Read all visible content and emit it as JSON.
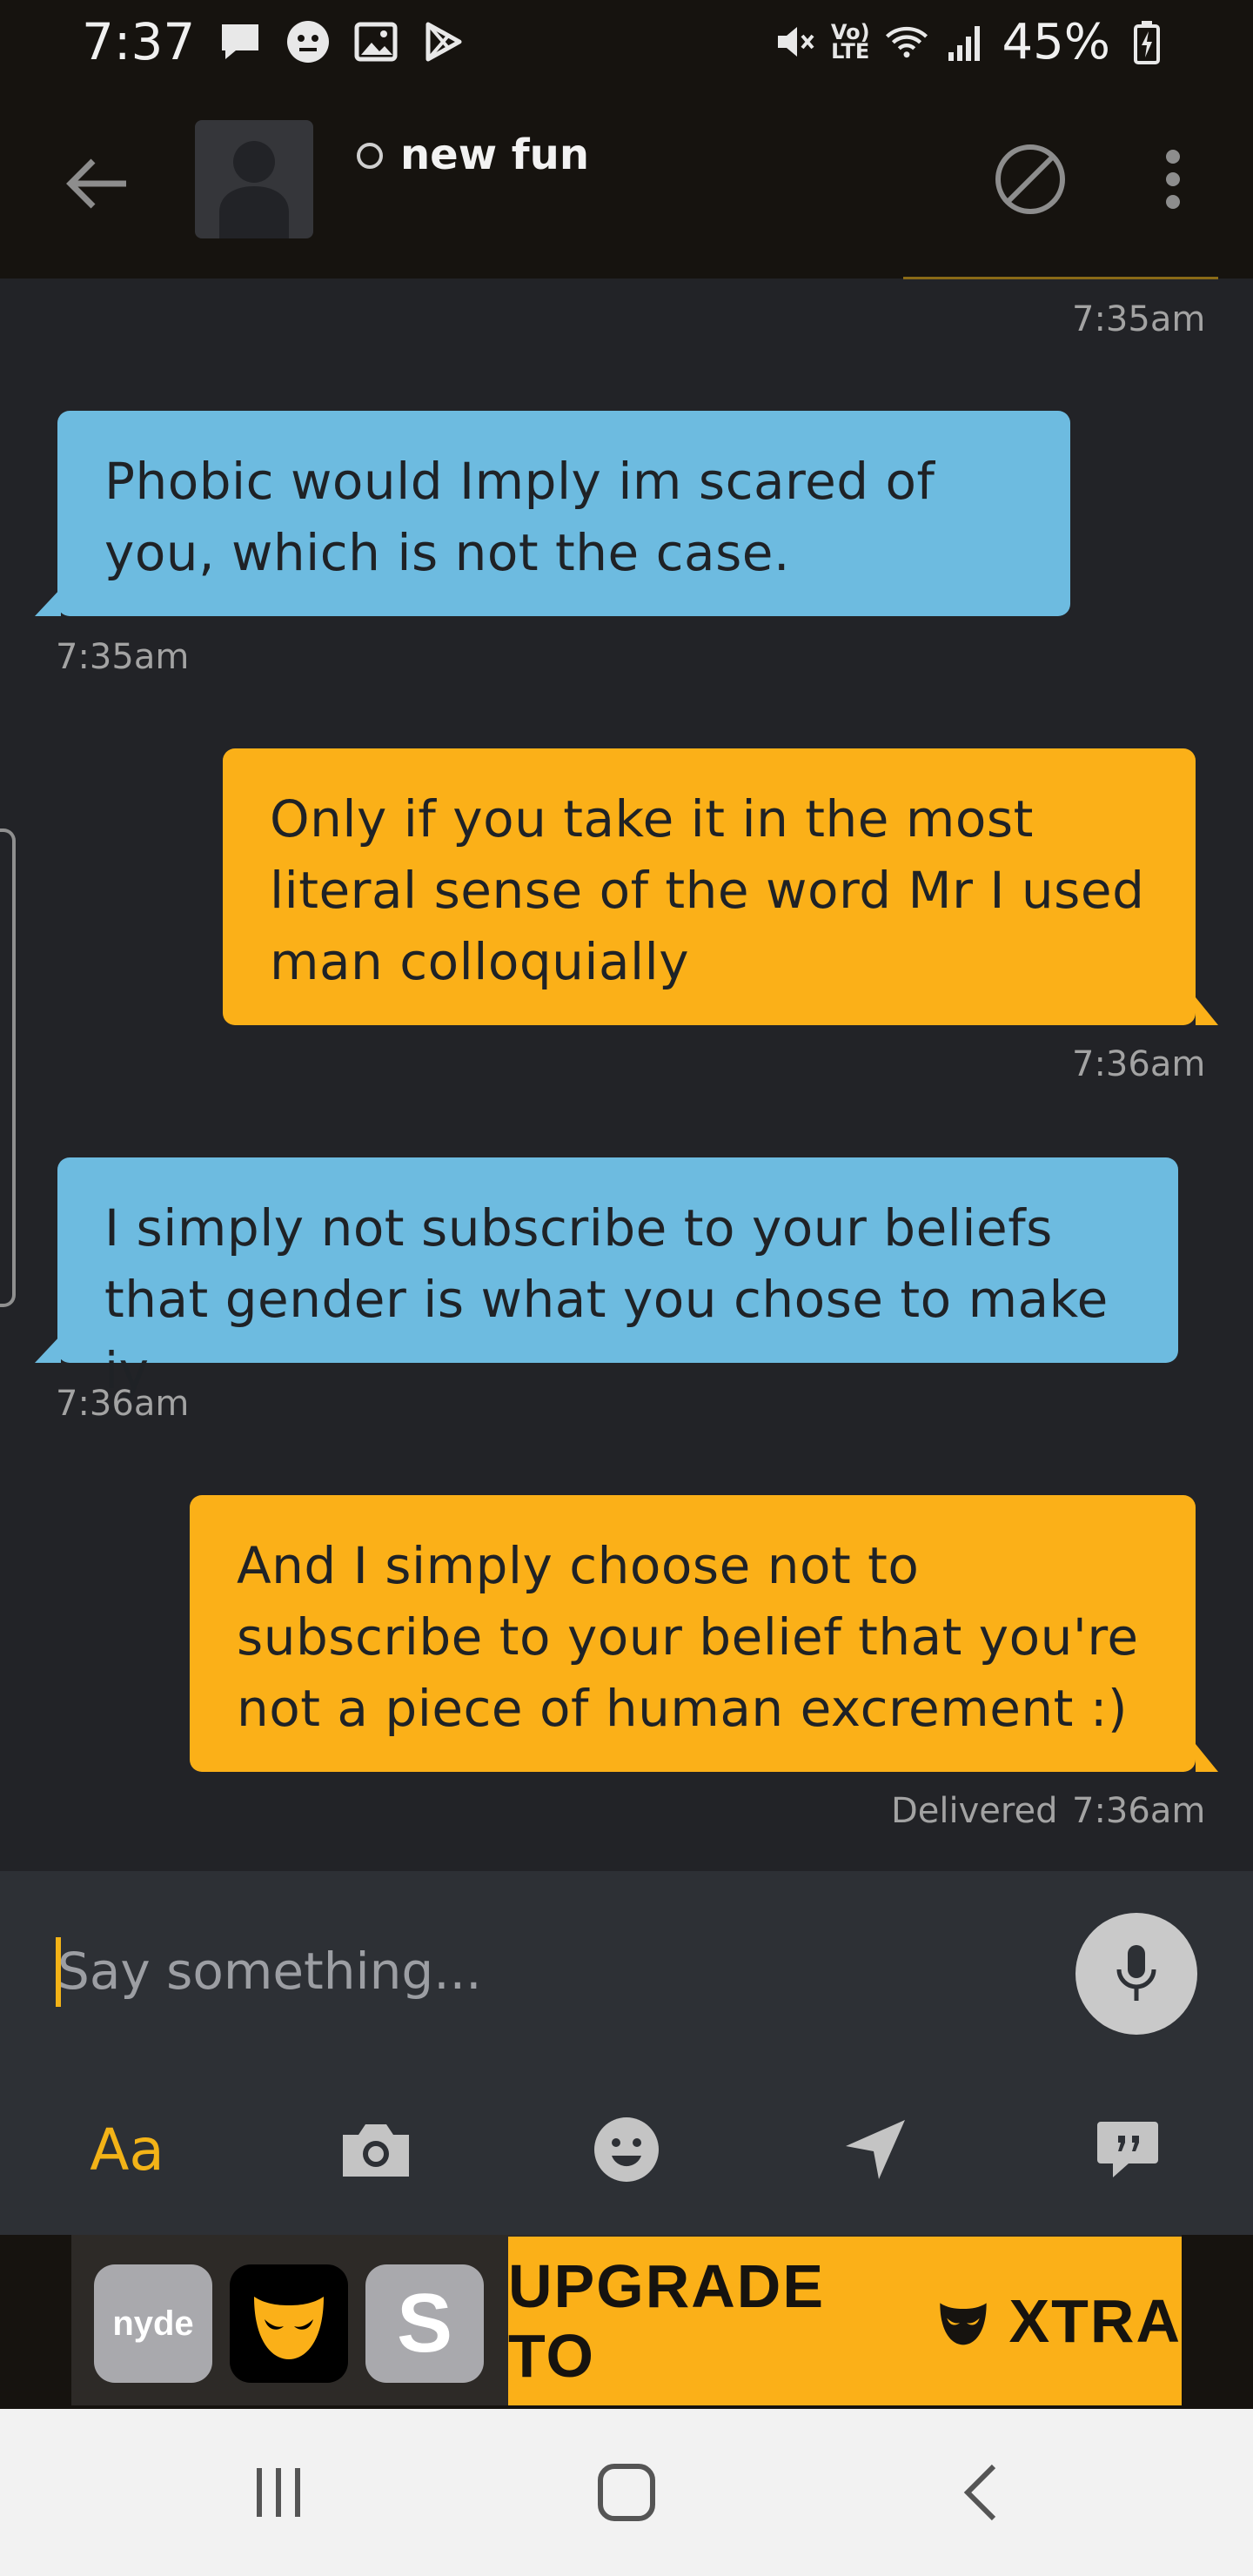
{
  "status_bar": {
    "time": "7:37",
    "battery": "45%",
    "network": "LTE",
    "volte": "Vo)"
  },
  "header": {
    "profile_name": "new fun",
    "icons": [
      "back-arrow-icon",
      "avatar",
      "online-status-dot",
      "block-icon",
      "more-vertical-icon"
    ]
  },
  "chat": {
    "top_timestamp": "7:35am",
    "messages": [
      {
        "direction": "incoming",
        "text": "Phobic would Imply im scared of you, which is not the case.",
        "time": "7:35am"
      },
      {
        "direction": "outgoing",
        "text": "Only if you take it in the most literal sense of the word Mr I used man colloquially",
        "time": "7:36am"
      },
      {
        "direction": "incoming",
        "text": "I simply not subscribe to your beliefs that gender is what you chose to make iy",
        "time": "7:36am"
      },
      {
        "direction": "outgoing",
        "text": "And I simply choose not to subscribe to your belief that you're not a piece of human excrement :)",
        "time": "7:36am",
        "status": "Delivered"
      }
    ]
  },
  "composer": {
    "placeholder": "Say something...",
    "format_label": "Aa",
    "tools": [
      "text-format",
      "camera-icon",
      "emoji-icon",
      "location-icon",
      "saved-phrases-icon"
    ]
  },
  "ad": {
    "app1": "nyde",
    "app3": "S",
    "upgrade_text_1": "UPGRADE TO",
    "upgrade_text_2": "XTRA"
  },
  "colors": {
    "accent": "#fbb018",
    "incoming_bubble": "#6dbbe0",
    "background": "#222327"
  }
}
